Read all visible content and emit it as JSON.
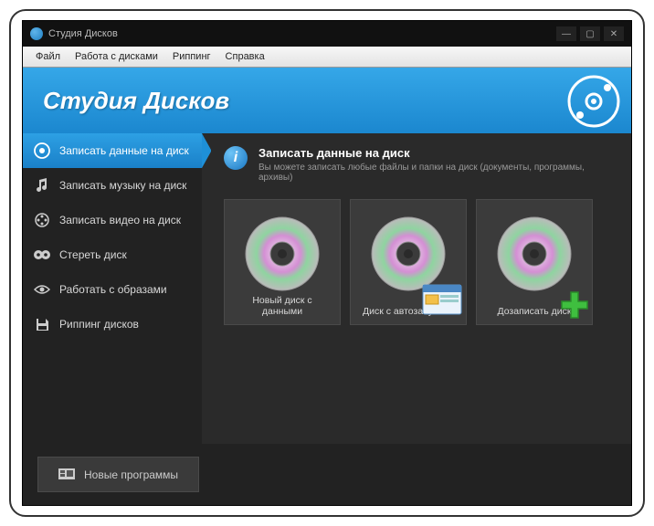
{
  "titlebar": {
    "title": "Студия Дисков"
  },
  "menubar": {
    "items": [
      "Файл",
      "Работа с дисками",
      "Риппинг",
      "Справка"
    ]
  },
  "banner": {
    "title": "Студия Дисков"
  },
  "sidebar": {
    "items": [
      {
        "label": "Записать данные на диск"
      },
      {
        "label": "Записать музыку на диск"
      },
      {
        "label": "Записать видео на диск"
      },
      {
        "label": "Стереть диск"
      },
      {
        "label": "Работать с образами"
      },
      {
        "label": "Риппинг дисков"
      }
    ]
  },
  "main": {
    "title": "Записать данные на диск",
    "description": "Вы можете записать любые файлы и папки на диск (документы, программы, архивы)",
    "cards": [
      {
        "label": "Новый диск с данными"
      },
      {
        "label": "Диск с автозапуском"
      },
      {
        "label": "Дозаписать диск"
      }
    ]
  },
  "footer": {
    "button": "Новые программы"
  }
}
